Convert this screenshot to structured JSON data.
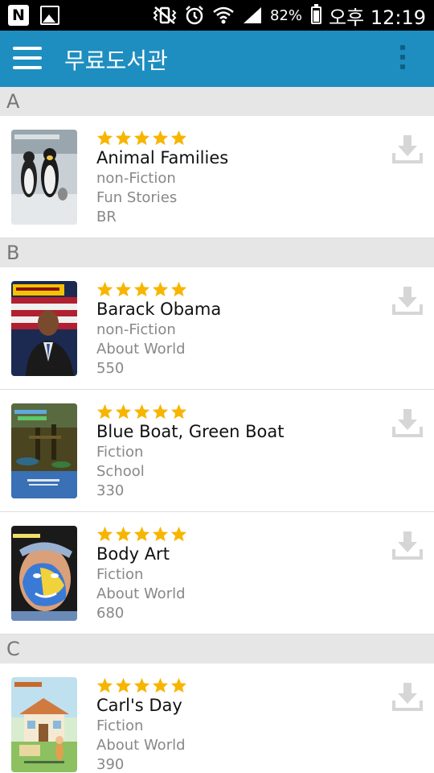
{
  "status_bar": {
    "left_icons": [
      "n-notification-icon",
      "image-notification-icon"
    ],
    "right_icons": [
      "vibrate-mute-icon",
      "alarm-icon",
      "wifi-icon",
      "signal-icon",
      "battery-icon"
    ],
    "battery": "82%",
    "time": "오후 12:19"
  },
  "app_bar": {
    "title": "무료도서관",
    "accent_color": "#1e8ec0"
  },
  "sections": [
    {
      "letter": "A",
      "books": [
        {
          "title": "Animal Families",
          "genre": "non-Fiction",
          "category": "Fun Stories",
          "level": "BR",
          "rating": 5,
          "cover_icon": "penguin-cover"
        }
      ]
    },
    {
      "letter": "B",
      "books": [
        {
          "title": "Barack Obama",
          "genre": "non-Fiction",
          "category": "About World",
          "level": "550",
          "rating": 5,
          "cover_icon": "portrait-cover"
        },
        {
          "title": "Blue Boat, Green Boat",
          "genre": "Fiction",
          "category": "School",
          "level": "330",
          "rating": 5,
          "cover_icon": "boat-cover"
        },
        {
          "title": "Body Art",
          "genre": "Fiction",
          "category": "About World",
          "level": "680",
          "rating": 5,
          "cover_icon": "facepaint-cover"
        }
      ]
    },
    {
      "letter": "C",
      "books": [
        {
          "title": "Carl's Day",
          "genre": "Fiction",
          "category": "About World",
          "level": "390",
          "rating": 5,
          "cover_icon": "house-cover"
        }
      ]
    }
  ],
  "colors": {
    "star": "#f7b500",
    "download_icon": "#d6d6d6",
    "section_bg": "#e6e6e6"
  }
}
